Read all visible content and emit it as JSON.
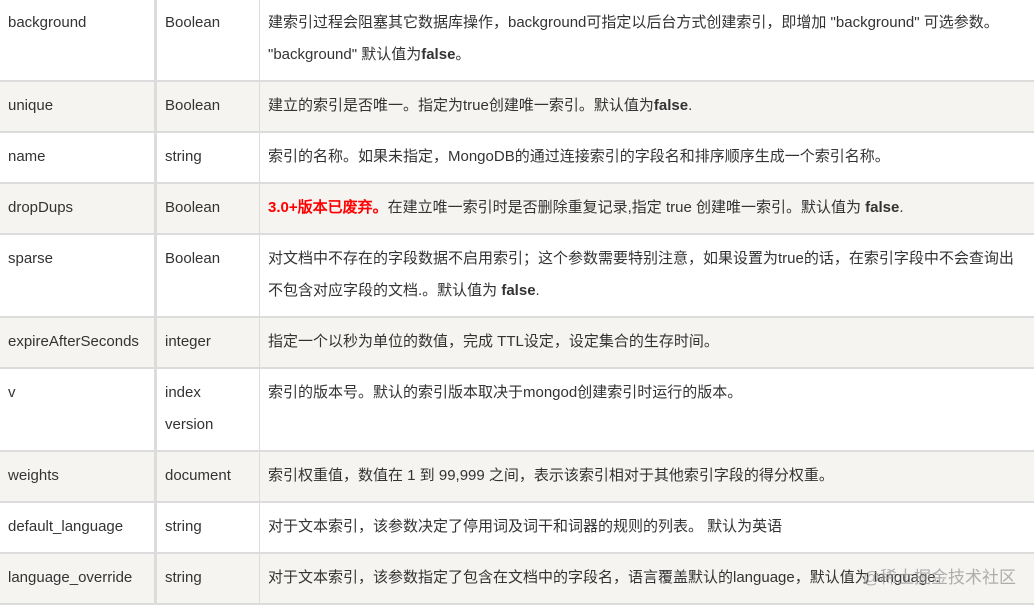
{
  "rows": [
    {
      "param": "background",
      "type": "Boolean",
      "desc": [
        {
          "t": "建索引过程会阻塞其它数据库操作，background可指定以后台方式创建索引，即增加 \"background\" 可选参数。 \"background\" 默认值为"
        },
        {
          "t": "false",
          "s": "b"
        },
        {
          "t": "。"
        }
      ]
    },
    {
      "param": "unique",
      "type": "Boolean",
      "desc": [
        {
          "t": "建立的索引是否唯一。指定为true创建唯一索引。默认值为"
        },
        {
          "t": "false",
          "s": "b"
        },
        {
          "t": "."
        }
      ]
    },
    {
      "param": "name",
      "type": "string",
      "desc": [
        {
          "t": "索引的名称。如果未指定，MongoDB的通过连接索引的字段名和排序顺序生成一个索引名称。"
        }
      ]
    },
    {
      "param": "dropDups",
      "type": "Boolean",
      "desc": [
        {
          "t": "3.0+版本已废弃。",
          "s": "red"
        },
        {
          "t": "在建立唯一索引时是否删除重复记录,指定 true 创建唯一索引。默认值为 "
        },
        {
          "t": "false",
          "s": "b"
        },
        {
          "t": "."
        }
      ]
    },
    {
      "param": "sparse",
      "type": "Boolean",
      "desc": [
        {
          "t": "对文档中不存在的字段数据不启用索引；这个参数需要特别注意，如果设置为true的话，在索引字段中不会查询出不包含对应字段的文档.。默认值为 "
        },
        {
          "t": "false",
          "s": "b"
        },
        {
          "t": "."
        }
      ]
    },
    {
      "param": "expireAfterSeconds",
      "type": "integer",
      "desc": [
        {
          "t": "指定一个以秒为单位的数值，完成 TTL设定，设定集合的生存时间。"
        }
      ]
    },
    {
      "param": "v",
      "type": "index version",
      "desc": [
        {
          "t": "索引的版本号。默认的索引版本取决于mongod创建索引时运行的版本。"
        }
      ]
    },
    {
      "param": "weights",
      "type": "document",
      "desc": [
        {
          "t": "索引权重值，数值在 1 到 99,999 之间，表示该索引相对于其他索引字段的得分权重。"
        }
      ]
    },
    {
      "param": "default_language",
      "type": "string",
      "desc": [
        {
          "t": "对于文本索引，该参数决定了停用词及词干和词器的规则的列表。 默认为英语"
        }
      ]
    },
    {
      "param": "language_override",
      "type": "string",
      "desc": [
        {
          "t": "对于文本索引，该参数指定了包含在文档中的字段名，语言覆盖默认的language，默认值为 language."
        }
      ]
    }
  ],
  "watermark": "@稀土掘金技术社区",
  "colors": {
    "alt_row": "#f5f4f1",
    "border": "#dcdcdc",
    "deprecated": "#ff0000"
  }
}
